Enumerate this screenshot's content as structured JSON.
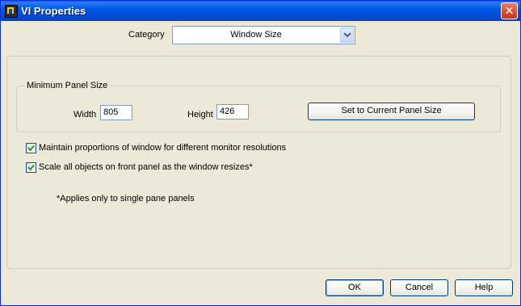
{
  "window": {
    "title": "VI Properties",
    "close_icon": "close-x",
    "app_icon": "labview-vi-icon"
  },
  "category": {
    "label": "Category",
    "selected": "Window Size"
  },
  "minimum_panel_size": {
    "legend": "Minimum Panel Size",
    "width_label": "Width",
    "width_value": "805",
    "height_label": "Height",
    "height_value": "426",
    "set_button": "Set to Current Panel Size"
  },
  "options": [
    {
      "label": "Maintain proportions of window for different monitor resolutions",
      "checked": true
    },
    {
      "label": "Scale all objects on front panel as the window resizes*",
      "checked": true
    }
  ],
  "note": "*Applies only to single pane panels",
  "buttons": {
    "ok": "OK",
    "cancel": "Cancel",
    "help": "Help"
  },
  "colors": {
    "titlebar": "#0058e6",
    "dialog_background": "#ece9d8",
    "close_button": "#d8543a"
  }
}
